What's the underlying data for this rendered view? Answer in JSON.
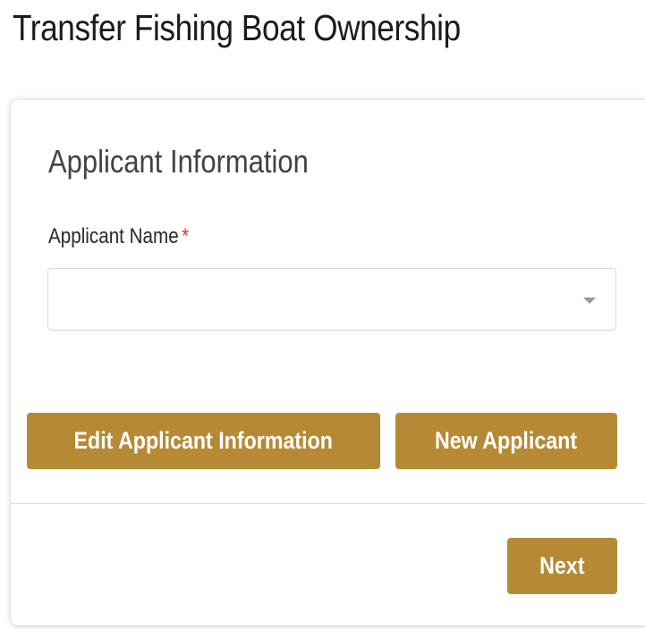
{
  "page": {
    "title": "Transfer Fishing Boat Ownership"
  },
  "form": {
    "section_heading": "Applicant Information",
    "applicant_name": {
      "label": "Applicant Name",
      "required_mark": "*",
      "value": "",
      "icon": "chevron-down-icon"
    },
    "buttons": {
      "edit_applicant": "Edit Applicant Information",
      "new_applicant": "New Applicant",
      "next": "Next"
    }
  },
  "colors": {
    "accent": "#b68a35",
    "required": "#e53935"
  }
}
